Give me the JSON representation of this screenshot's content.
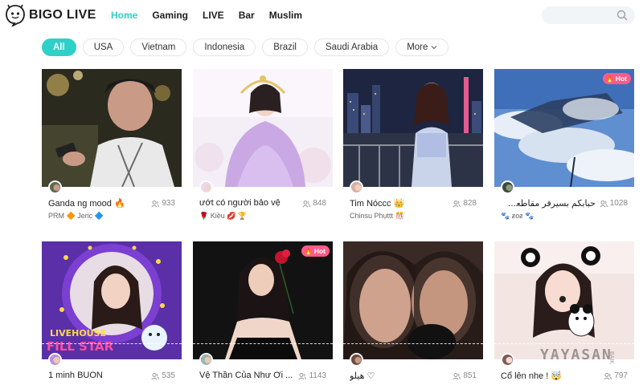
{
  "brand": {
    "name": "BIGO LIVE",
    "accent": "#2fd0c8",
    "hot_color": "#ff5b8a"
  },
  "nav": {
    "items": [
      {
        "label": "Home",
        "active": true
      },
      {
        "label": "Gaming",
        "active": false
      },
      {
        "label": "LIVE",
        "active": false
      },
      {
        "label": "Bar",
        "active": false
      },
      {
        "label": "Muslim",
        "active": false
      }
    ]
  },
  "search": {
    "placeholder": "",
    "icon": "search-icon"
  },
  "filters": {
    "items": [
      "All",
      "USA",
      "Vietnam",
      "Indonesia",
      "Brazil",
      "Saudi Arabia"
    ],
    "more_label": "More",
    "active": "All"
  },
  "hot_label": "Hot",
  "cards": [
    {
      "title": "Ganda ng mood 🔥",
      "viewers": "933",
      "sub": "PRM 🔶 Jeric 🔷",
      "hot": false
    },
    {
      "title": "ướt có người bảo vệ",
      "viewers": "848",
      "sub": "🌹 Kiều 💋 🏆",
      "hot": false
    },
    {
      "title": "Tim Nóccc 👑",
      "viewers": "828",
      "sub": "Chinsu Phụttt 🎊",
      "hot": false
    },
    {
      "title": "حبابكم بسيرفر مقاطعه بلاين",
      "viewers": "1028",
      "sub": "🐾 ƶoƶ 🐾",
      "hot": true
    },
    {
      "title": "1 minh BUON",
      "viewers": "535",
      "sub": "",
      "hot": false
    },
    {
      "title": "Vệ Thần Của Như Ơi ...",
      "viewers": "1143",
      "sub": "",
      "hot": true
    },
    {
      "title": "هيلو ♡",
      "viewers": "851",
      "sub": "",
      "hot": false
    },
    {
      "title": "Cổ lên nhe ! 🤯",
      "viewers": "797",
      "sub": "",
      "hot": false
    }
  ],
  "thumb_overlays": {
    "livehouse_line1": "LIVEHOUSE",
    "livehouse_line2": "FILL STAR"
  },
  "watermark": {
    "text": "YAYASAN",
    "sub": "BAIK"
  }
}
